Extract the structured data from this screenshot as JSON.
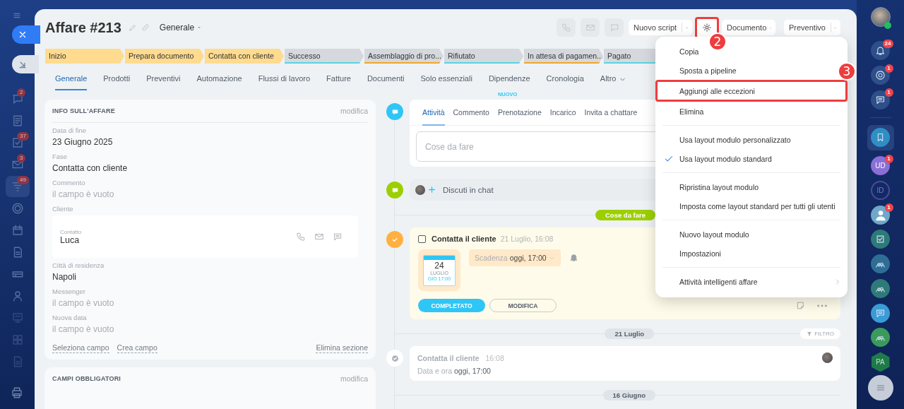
{
  "left_rail": {
    "items": [
      {
        "kind": "chat",
        "badge": "2",
        "selected": false
      },
      {
        "kind": "list",
        "selected": false
      },
      {
        "kind": "task",
        "badge": "37",
        "selected": false
      },
      {
        "kind": "mail",
        "badge": "3",
        "selected": false
      },
      {
        "kind": "funnel",
        "badge": "49",
        "selected": true
      },
      {
        "kind": "ring",
        "selected": false
      },
      {
        "kind": "calendar",
        "selected": false
      },
      {
        "kind": "document",
        "selected": false
      },
      {
        "kind": "drive",
        "selected": false
      },
      {
        "kind": "users",
        "selected": false
      },
      {
        "kind": "board",
        "selected": false
      },
      {
        "kind": "grid",
        "selected": false
      },
      {
        "kind": "document",
        "selected": false
      }
    ]
  },
  "header": {
    "title": "Affare #213",
    "category": "Generale",
    "contact_buttons": [
      {
        "kind": "phone",
        "disabled": true
      },
      {
        "kind": "mail",
        "disabled": true
      },
      {
        "kind": "chat",
        "disabled": true
      }
    ],
    "script_button": "Nuovo script",
    "settings_callout": "2",
    "document_button": "Documento",
    "quote_button": "Preventivo"
  },
  "stages": [
    {
      "label": "Inizio",
      "reached": true,
      "color": "#ffdb8f"
    },
    {
      "label": "Prepara documento",
      "reached": true,
      "color": "#ffdb8f"
    },
    {
      "label": "Contatta con cliente",
      "reached": true,
      "color": "#ffdb8f"
    },
    {
      "label": "Successo",
      "reached": false,
      "color": "#55d6e2"
    },
    {
      "label": "Assemblaggio di pro...",
      "reached": false,
      "color": "#f5a623"
    },
    {
      "label": "Rifiutato",
      "reached": false,
      "color": "#55d6e2"
    },
    {
      "label": "In attesa di pagamen...",
      "reached": false,
      "color": "#f5a623"
    },
    {
      "label": "Pagato",
      "reached": false,
      "color": "#55d6e2"
    }
  ],
  "tabs": [
    {
      "label": "Generale",
      "selected": true
    },
    {
      "label": "Prodotti",
      "selected": false
    },
    {
      "label": "Preventivi",
      "selected": false
    },
    {
      "label": "Automazione",
      "selected": false
    },
    {
      "label": "Flussi di lavoro",
      "selected": false
    },
    {
      "label": "Fatture",
      "selected": false
    },
    {
      "label": "Documenti",
      "selected": false
    },
    {
      "label": "Solo essenziali",
      "selected": false
    },
    {
      "label": "Dipendenze",
      "selected": false
    },
    {
      "label": "Cronologia",
      "selected": false
    },
    {
      "label": "Altro",
      "selected": false,
      "kind": "more"
    }
  ],
  "info_card": {
    "title": "INFO SULL'AFFARE",
    "edit_link": "modifica",
    "fields": [
      {
        "kind": "value",
        "label": "Data di fine",
        "value": "23 Giugno 2025"
      },
      {
        "kind": "value",
        "label": "Fase",
        "value": "Contatta con cliente"
      },
      {
        "kind": "empty",
        "label": "Commento",
        "value": "il campo è vuoto"
      },
      {
        "kind": "client",
        "label": "Cliente",
        "sublabel": "Contatto",
        "value": "Luca"
      },
      {
        "kind": "value",
        "label": "Città di residenza",
        "value": "Napoli"
      },
      {
        "kind": "empty",
        "label": "Messenger",
        "value": "il campo è vuoto"
      },
      {
        "kind": "empty",
        "label": "Nuova data",
        "value": "il campo è vuoto"
      }
    ],
    "links": [
      "Seleziona campo",
      "Crea campo"
    ],
    "delete_link": "Elimina sezione"
  },
  "required_card": {
    "title": "CAMPI OBBLIGATORI",
    "edit_link": "modifica"
  },
  "composer": {
    "tabs": [
      {
        "label": "Attività",
        "selected": true
      },
      {
        "label": "Commento",
        "selected": false
      },
      {
        "label": "Prenotazione",
        "selected": false,
        "badge": "NUOVO"
      },
      {
        "label": "Incarico",
        "selected": false
      },
      {
        "label": "Invita a chattare",
        "selected": false
      }
    ],
    "placeholder": "Cose da fare"
  },
  "chat": {
    "label": "Discuti in chat"
  },
  "timeline": [
    {
      "kind": "divider",
      "label": "Cose da fare",
      "highlight": true
    },
    {
      "kind": "activity",
      "done": false,
      "title": "Contatta il cliente",
      "time": "21 Luglio, 16:08",
      "date": {
        "day": "24",
        "month": "LUGLIO",
        "line": "GIO 17:00"
      },
      "deadline_label": "Scadenza",
      "deadline_value": "oggi, 17:00",
      "buttons": [
        "COMPLETATO",
        "MODIFICA"
      ]
    },
    {
      "kind": "divider",
      "label": "21 Luglio",
      "highlight": false,
      "filter": "FILTRO"
    },
    {
      "kind": "history",
      "title": "Contatta il cliente",
      "time": "16:08",
      "detail_label": "Data e ora",
      "detail_value": "oggi, 17:00"
    },
    {
      "kind": "divider",
      "label": "16 Giugno",
      "highlight": false
    }
  ],
  "menu": {
    "groups": [
      [
        {
          "label": "Copia",
          "checked": false,
          "submenu": false
        },
        {
          "label": "Sposta a pipeline",
          "checked": false,
          "submenu": false
        },
        {
          "label": "Aggiungi alle eccezioni",
          "checked": false,
          "submenu": false,
          "callout": "3"
        },
        {
          "label": "Elimina",
          "checked": false,
          "submenu": false
        }
      ],
      [
        {
          "label": "Usa layout modulo personalizzato",
          "checked": false,
          "submenu": false
        },
        {
          "label": "Usa layout modulo standard",
          "checked": true,
          "submenu": false
        }
      ],
      [
        {
          "label": "Ripristina layout modulo",
          "checked": false,
          "submenu": false
        },
        {
          "label": "Imposta come layout standard per tutti gli utenti",
          "checked": false,
          "submenu": false
        }
      ],
      [
        {
          "label": "Nuovo layout modulo",
          "checked": false,
          "submenu": false
        },
        {
          "label": "Impostazioni",
          "checked": false,
          "submenu": false
        }
      ],
      [
        {
          "label": "Attività intelligenti affare",
          "checked": false,
          "submenu": true
        }
      ]
    ]
  },
  "right_rail": {
    "items": [
      {
        "kind": "bell",
        "badge": "24",
        "selected": false,
        "color": "#2f4f8a"
      },
      {
        "kind": "target",
        "badge": "1",
        "selected": false,
        "color": "#2f4f8a"
      },
      {
        "kind": "swap",
        "badge": "1",
        "selected": false,
        "color": "#2f4f8a"
      },
      {
        "kind": "bookmark",
        "selected": true,
        "color": "#2f8fc4"
      },
      {
        "kind": "initials",
        "text": "UD",
        "badge": "1",
        "selected": false,
        "color": "#8a6fd6"
      },
      {
        "kind": "initials",
        "text": "ID",
        "selected": false,
        "color": "#4d4a9e"
      },
      {
        "kind": "avatar",
        "badge": "1",
        "selected": false,
        "color": "#6fa8c9"
      },
      {
        "kind": "check",
        "selected": false,
        "color": "#2d7a78"
      },
      {
        "kind": "group",
        "selected": false,
        "color": "#2e6e96"
      },
      {
        "kind": "group",
        "selected": false,
        "color": "#2d7a78"
      },
      {
        "kind": "swap",
        "selected": false,
        "color": "#3a9bd6"
      },
      {
        "kind": "group",
        "selected": false,
        "color": "#3a9a5c"
      },
      {
        "kind": "hexagon",
        "text": "PA",
        "selected": false,
        "color": "#1f7a4a"
      }
    ]
  }
}
